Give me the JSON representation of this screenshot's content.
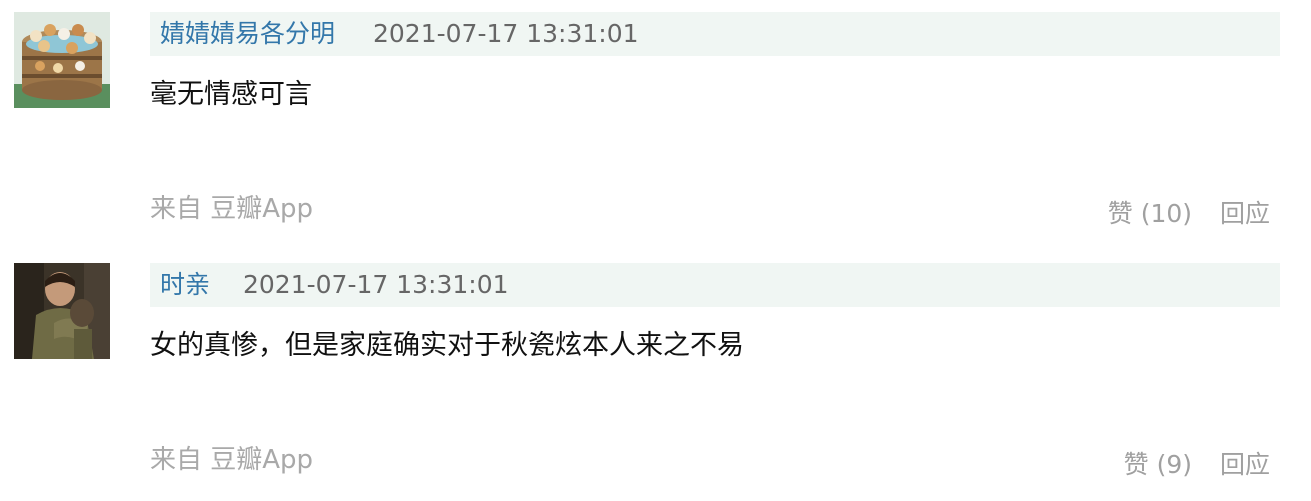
{
  "comments": [
    {
      "author": "婧婧婧易各分明",
      "time": "2021-07-17 13:31:01",
      "content": "毫无情感可言",
      "source": "来自 豆瓣App",
      "like_label": "赞 (10)",
      "reply_label": "回应",
      "avatar_icon": "avatar-hot-tub-animals-icon"
    },
    {
      "author": "时亲",
      "time": "2021-07-17 13:31:01",
      "content": "女的真惨，但是家庭确实对于秋瓷炫本人来之不易",
      "source": "来自 豆瓣App",
      "like_label": "赞 (9)",
      "reply_label": "回应",
      "avatar_icon": "avatar-photo-hug-icon"
    }
  ],
  "colors": {
    "author": "#3377aa",
    "header_bg": "#f0f6f3",
    "muted": "#a0a0a0"
  }
}
